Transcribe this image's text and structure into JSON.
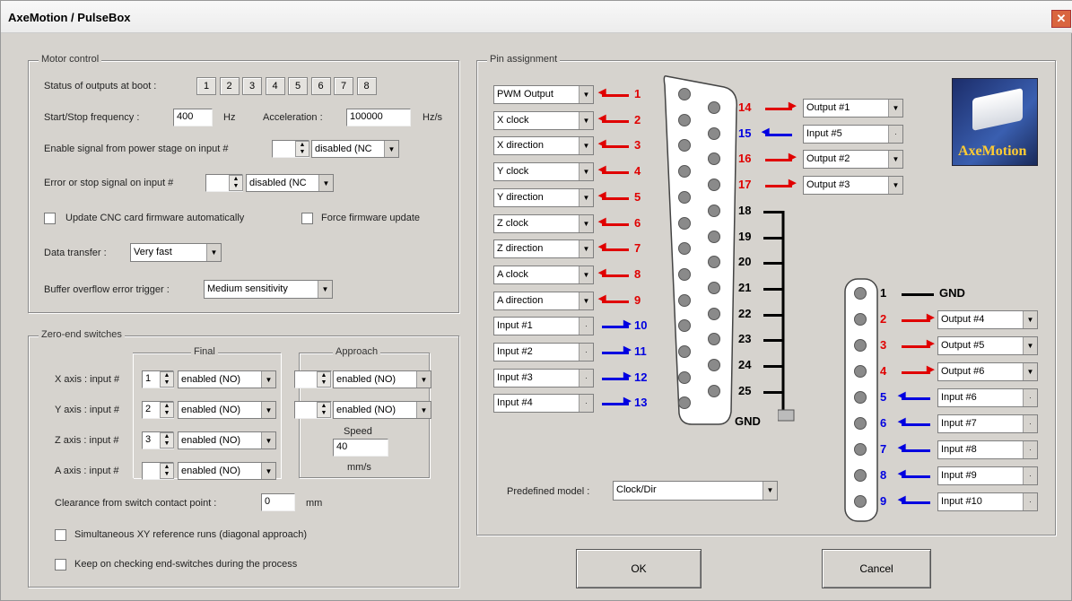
{
  "window": {
    "title": "AxeMotion / PulseBox",
    "close": "✕"
  },
  "motor": {
    "group": "Motor control",
    "boot_label": "Status of outputs at boot :",
    "boot": [
      "1",
      "2",
      "3",
      "4",
      "5",
      "6",
      "7",
      "8"
    ],
    "startstop_label": "Start/Stop frequency :",
    "startstop_value": "400",
    "hz": "Hz",
    "accel_label": "Acceleration :",
    "accel_value": "100000",
    "hzs": "Hz/s",
    "enable_label": "Enable signal from power stage on input #",
    "enable_value": "disabled (NC",
    "error_label": "Error or stop signal on input #",
    "error_value": "disabled (NC",
    "update_fw": "Update CNC card firmware automatically",
    "force_fw": "Force firmware update",
    "transfer_label": "Data transfer :",
    "transfer_value": "Very fast",
    "buffer_label": "Buffer overflow error trigger :",
    "buffer_value": "Medium sensitivity"
  },
  "zero": {
    "group": "Zero-end switches",
    "final": "Final",
    "approach": "Approach",
    "axes": [
      {
        "label": "X axis :  input #",
        "num": "1",
        "final": "enabled (NO)",
        "approach": "enabled (NO)"
      },
      {
        "label": "Y axis :  input #",
        "num": "2",
        "final": "enabled (NO)",
        "approach": "enabled (NO)"
      },
      {
        "label": "Z axis :  input #",
        "num": "3",
        "final": "enabled (NO)"
      },
      {
        "label": "A axis :  input #",
        "num": "",
        "final": "enabled (NO)"
      }
    ],
    "speed": "Speed",
    "speed_value": "40",
    "speed_unit": "mm/s",
    "clearance_label": "Clearance from switch contact point :",
    "clearance_value": "0",
    "mm": "mm",
    "simul": "Simultaneous XY reference runs (diagonal approach)",
    "keep": "Keep on checking end-switches during the process"
  },
  "pins": {
    "group": "Pin assignment",
    "left": [
      {
        "n": "1",
        "value": "PWM Output",
        "dir": "out"
      },
      {
        "n": "2",
        "value": "X clock",
        "dir": "out"
      },
      {
        "n": "3",
        "value": "X direction",
        "dir": "out"
      },
      {
        "n": "4",
        "value": "Y clock",
        "dir": "out"
      },
      {
        "n": "5",
        "value": "Y direction",
        "dir": "out"
      },
      {
        "n": "6",
        "value": "Z clock",
        "dir": "out"
      },
      {
        "n": "7",
        "value": "Z direction",
        "dir": "out"
      },
      {
        "n": "8",
        "value": "A clock",
        "dir": "out"
      },
      {
        "n": "9",
        "value": "A direction",
        "dir": "out"
      },
      {
        "n": "10",
        "value": "Input #1",
        "dir": "in"
      },
      {
        "n": "11",
        "value": "Input #2",
        "dir": "in"
      },
      {
        "n": "12",
        "value": "Input #3",
        "dir": "in"
      },
      {
        "n": "13",
        "value": "Input #4",
        "dir": "in"
      }
    ],
    "right": [
      {
        "n": "14",
        "value": "Output #1",
        "dir": "out"
      },
      {
        "n": "15",
        "value": "Input #5",
        "dir": "in"
      },
      {
        "n": "16",
        "value": "Output #2",
        "dir": "out"
      },
      {
        "n": "17",
        "value": "Output #3",
        "dir": "out"
      }
    ],
    "gnd_pins": [
      "18",
      "19",
      "20",
      "21",
      "22",
      "23",
      "24",
      "25"
    ],
    "gnd": "GND",
    "second": [
      {
        "n": "1",
        "value": "GND",
        "dir": "gnd"
      },
      {
        "n": "2",
        "value": "Output #4",
        "dir": "out"
      },
      {
        "n": "3",
        "value": "Output #5",
        "dir": "out"
      },
      {
        "n": "4",
        "value": "Output #6",
        "dir": "out"
      },
      {
        "n": "5",
        "value": "Input #6",
        "dir": "in"
      },
      {
        "n": "6",
        "value": "Input #7",
        "dir": "in"
      },
      {
        "n": "7",
        "value": "Input #8",
        "dir": "in"
      },
      {
        "n": "8",
        "value": "Input #9",
        "dir": "in"
      },
      {
        "n": "9",
        "value": "Input #10",
        "dir": "in"
      }
    ],
    "model_label": "Predefined model :",
    "model_value": "Clock/Dir",
    "logo": "AxeMotion"
  },
  "buttons": {
    "ok": "OK",
    "cancel": "Cancel"
  }
}
